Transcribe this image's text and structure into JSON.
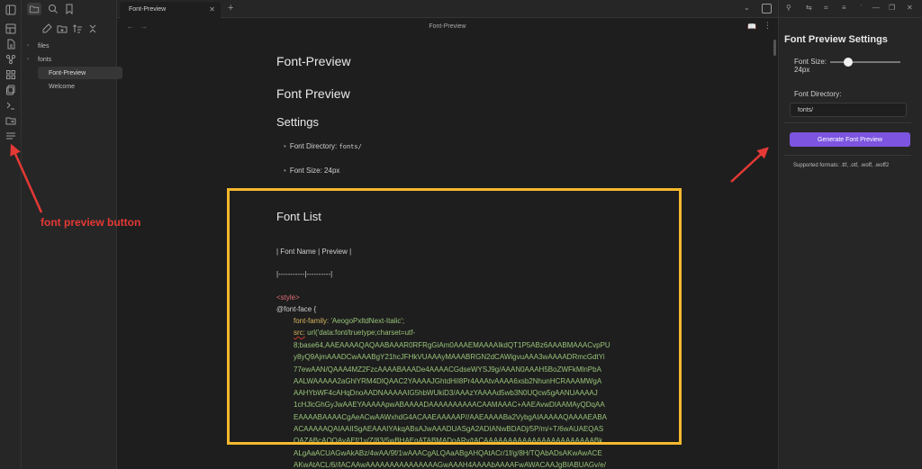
{
  "tab": {
    "title": "Font-Preview",
    "close": "✕",
    "new": "+"
  },
  "note_header": {
    "title": "Font-Preview",
    "back": "←",
    "forward": "→",
    "more": "⋮"
  },
  "file_tree": {
    "folders": [
      {
        "name": "files"
      },
      {
        "name": "fonts"
      }
    ],
    "files": [
      {
        "name": "Font-Preview"
      },
      {
        "name": "Welcome"
      }
    ]
  },
  "document": {
    "inline_title": "Font-Preview",
    "heading1": "Font Preview",
    "heading_settings": "Settings",
    "bullets": [
      {
        "label": "Font Directory:",
        "code": "fonts/"
      },
      {
        "label": "Font Size: 24px"
      }
    ],
    "heading_list": "Font List",
    "table_header": "| Font Name | Preview |",
    "table_sep": "|-----------|----------|",
    "style_tag": "<style>",
    "font_face": "@font-face {",
    "font_family_prop": "font-family:",
    "font_family_val": "'AeogoPxltdNext-Italic';",
    "src_prop": "src:",
    "src_val": " url('data:font/truetype;charset=utf-",
    "base64_lines": [
      "8;base64,AAEAAAAQAQAABAAAR0RFRgGiAm0AAAEMAAAAIkdQT1P5ABz6AAABMAAACvpPU",
      "y8yQ9AjmAAADCwAAABgY21hcJFHkVUAAAyMAAABRGN2dCAWigvuAAA3wAAAADRmcGdtYi",
      "77ewAAN/QAAA4MZ2FzcAAAABAAADe4AAAACGdseWYSJ9g/AAAN0AAAH5BoZWFkMlnPbA",
      "AALWAAAAA2aGhlYRM4DlQAAC2YAAAAJGhtdHiI8Pr4AAAtvAAAA6xsb2NhunHCRAAAMWgA",
      "AAHYbWF4cAHqDnoAADNAAAAAIG5hbWUkiD3/AAAzYAAAAd5wb3N0UQcw5gAANUAAAAJ",
      "1cHJlcGhGyJwAAEYAAAAApwABAAAADAAAAAAAAAACAAMAAAC+AAEAvwDIAAMAyQDqAA",
      "EAAAABAAAACgAeACwAAWxhdG4ACAAEAAAAAP//AAEAAAABa2VybgAIAAAAAQAAAAEABA",
      "ACAAAAAQAIAAIISgAEAAAIYAkqABsAJwAAADUASgA2ADIANwBDADj/5P/m/+T/6wAUAEQAS",
      "QAZABcAOQAvAEf/1v/Z/83/5wBHAEgATABMADoARv/tACAAAAAAAAAAAAAAAAAAAAAAABk",
      "ALgAaACUAGwAkABz/4wAA/9f/1wAAACgALQAaABgAHQAtACr/1f/g/8H/TQAbADsAKwAwACE",
      "AKwAtACL/6//lACAAwAAAAAAAAAAAAAAAGwAAAH4AAAAbAAAAFwAWACAAJgBIABUAGv/e/"
    ]
  },
  "right_panel": {
    "title": "Font Preview Settings",
    "font_size_label": "Font Size:",
    "font_size_value": "24px",
    "font_size_slider_fraction": 0.25,
    "font_dir_label": "Font Directory:",
    "font_dir_value": "fonts/",
    "generate_button": "Generate Font Preview",
    "supported": "Supported formats: .ttf, .otf, .woff, .woff2"
  },
  "annotation": {
    "label": "font preview button",
    "color": "#e53935"
  },
  "colors": {
    "accent": "#7c54e0",
    "highlight_box": "#f5b82e",
    "background": "#1e1e1e",
    "sidebar": "#262626"
  }
}
